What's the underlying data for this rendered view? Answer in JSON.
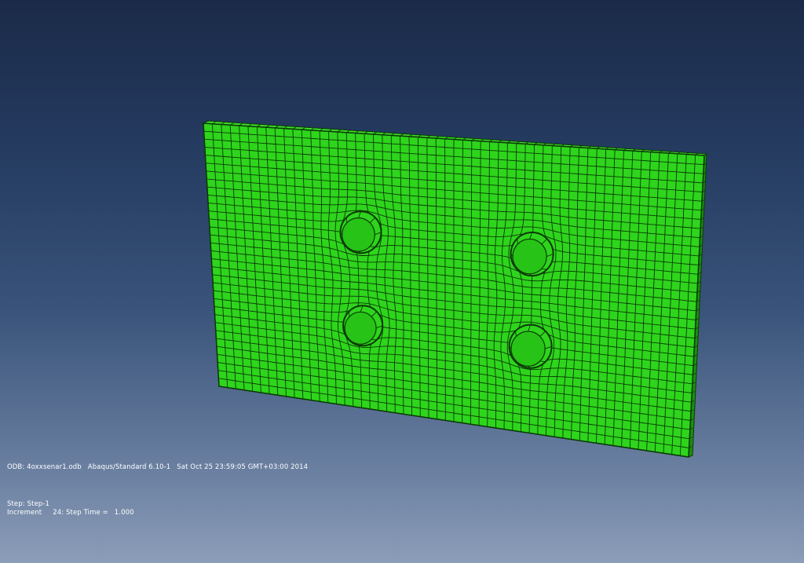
{
  "viewport": {
    "model_color": "#2ed51c",
    "mesh_color": "#0b3a07",
    "background_top": "#1b2a48",
    "background_bottom": "#8c9db8"
  },
  "info": {
    "odb_label": "ODB: 4oxxsenar1.odb",
    "solver": "Abaqus/Standard 6.10-1",
    "date": "Sat Oct 25 23:59:05 GMT+03:00 2014",
    "step_label": "Step: Step-1",
    "increment_label": "Increment",
    "increment_value": "24: Step Time =",
    "step_time": "1.000"
  }
}
